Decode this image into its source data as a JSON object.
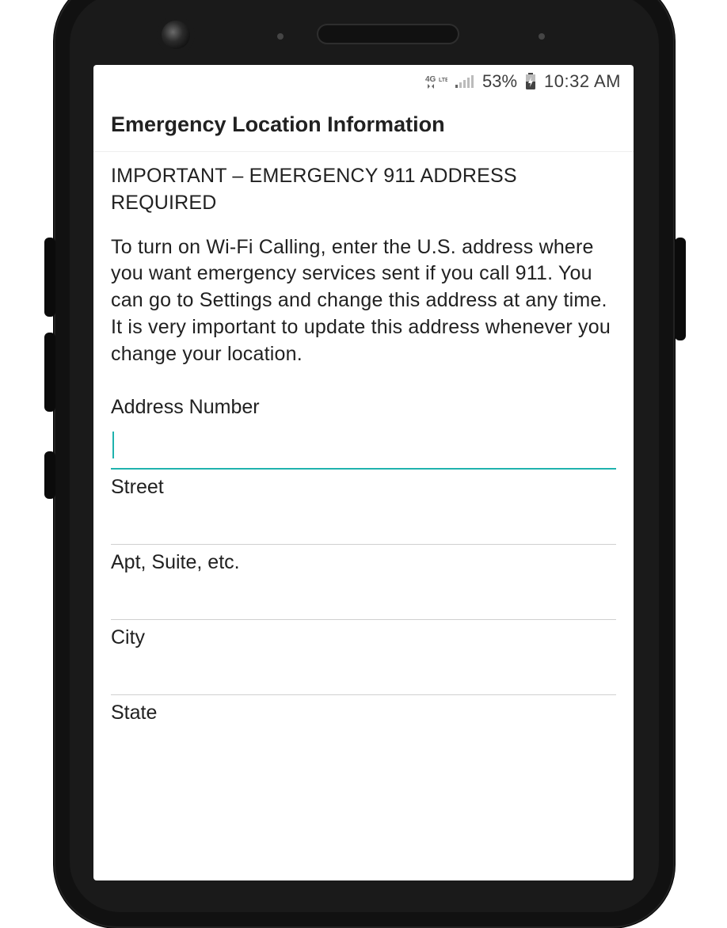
{
  "status_bar": {
    "network_indicator": "4G LTE",
    "signal_strength": "weak",
    "battery_percent": "53%",
    "battery_state": "charging",
    "time": "10:32 AM"
  },
  "header": {
    "title": "Emergency Location Information"
  },
  "notice": {
    "heading": "IMPORTANT – EMERGENCY 911 ADDRESS REQUIRED",
    "body": "To turn on Wi-Fi Calling, enter the U.S. address where you want emergency services sent if you call 911. You can go to Settings and change this address at any time. It is very important to update this address whenever you change your location."
  },
  "form": {
    "fields": [
      {
        "label": "Address Number",
        "value": "",
        "focused": true
      },
      {
        "label": "Street",
        "value": "",
        "focused": false
      },
      {
        "label": "Apt, Suite, etc.",
        "value": "",
        "focused": false
      },
      {
        "label": "City",
        "value": "",
        "focused": false
      },
      {
        "label": "State",
        "value": "",
        "focused": false
      }
    ]
  }
}
